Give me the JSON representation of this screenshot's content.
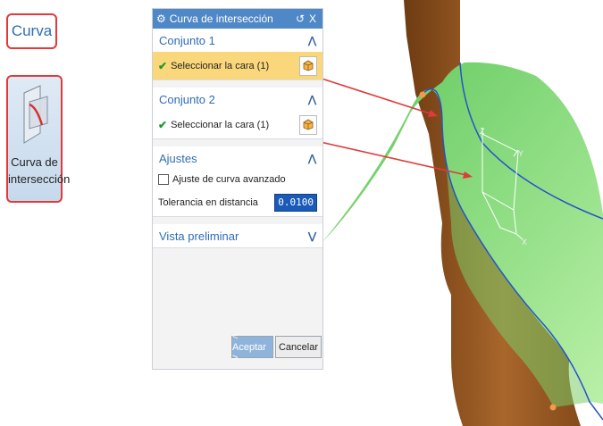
{
  "ribbon": {
    "group_label": "Curva",
    "tool_line1": "Curva de",
    "tool_line2": "intersección",
    "tool_icon": "intersection-curve-icon"
  },
  "dialog": {
    "title": "Curva de intersección",
    "reset_glyph": "↺",
    "close_glyph": "X",
    "set1": {
      "title": "Conjunto 1",
      "select_label": "Seleccionar la cara (1)"
    },
    "set2": {
      "title": "Conjunto 2",
      "select_label": "Seleccionar la cara (1)"
    },
    "settings": {
      "title": "Ajustes",
      "advanced_fit_label": "Ajuste de curva avanzado",
      "advanced_fit_checked": false,
      "tolerance_label": "Tolerancia en distancia",
      "tolerance_value": "0.0100"
    },
    "preview": {
      "title": "Vista preliminar"
    },
    "ok_label": "< Aceptar >",
    "cancel_label": "Cancelar"
  },
  "viewport": {
    "axis_labels": {
      "z": "Z",
      "y": "Y",
      "x": "X"
    }
  },
  "colors": {
    "accent": "#2e6db4",
    "selection": "#fbd77c",
    "callout": "#e03a3a",
    "surface_green": "#8ee07a",
    "body_brown": "#9b5a24"
  }
}
